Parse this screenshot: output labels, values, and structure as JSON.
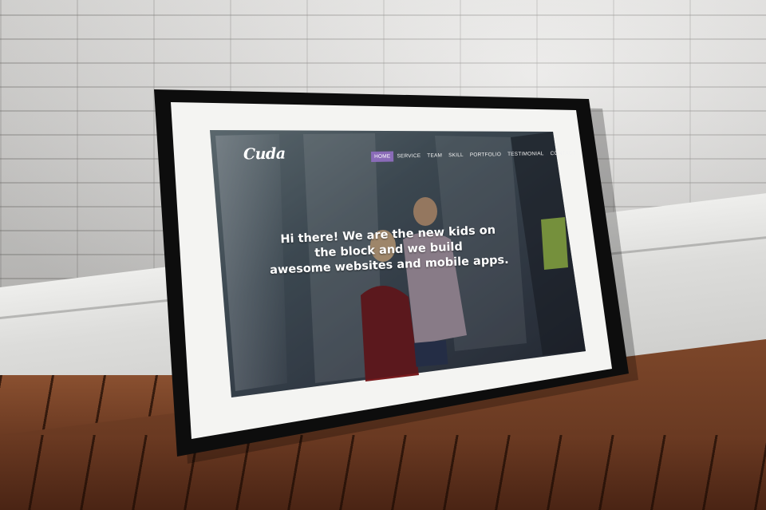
{
  "site": {
    "logo_text": "Cuda",
    "nav": [
      {
        "label": "HOME",
        "active": true
      },
      {
        "label": "SERVICE",
        "active": false
      },
      {
        "label": "TEAM",
        "active": false
      },
      {
        "label": "SKILL",
        "active": false
      },
      {
        "label": "PORTFOLIO",
        "active": false
      },
      {
        "label": "TESTIMONIAL",
        "active": false
      },
      {
        "label": "CONTACT",
        "active": false
      }
    ],
    "hero_line1": "Hi there! We are the new kids on the block and we build",
    "hero_line2": "awesome websites and mobile apps."
  },
  "colors": {
    "accent": "#8a6bb8",
    "frame": "#0d0d0d",
    "mat": "#f4f4f2",
    "wall": "#d9d8d6",
    "floor": "#6a3a22"
  }
}
